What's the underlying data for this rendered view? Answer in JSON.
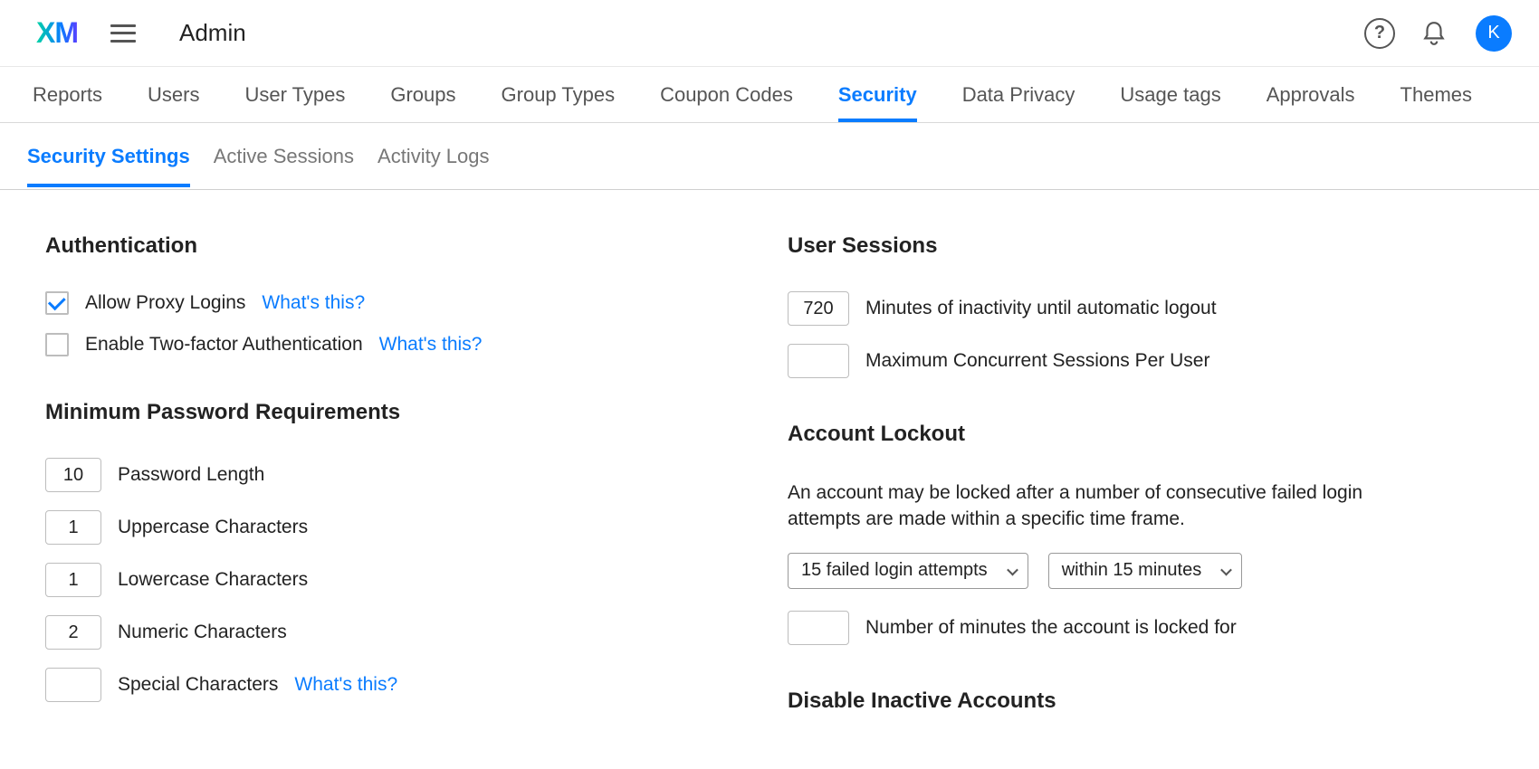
{
  "header": {
    "logo_text": "XM",
    "title": "Admin",
    "avatar_initial": "K"
  },
  "primary_tabs": [
    {
      "label": "Reports"
    },
    {
      "label": "Users"
    },
    {
      "label": "User Types"
    },
    {
      "label": "Groups"
    },
    {
      "label": "Group Types"
    },
    {
      "label": "Coupon Codes"
    },
    {
      "label": "Security",
      "active": true
    },
    {
      "label": "Data Privacy"
    },
    {
      "label": "Usage tags"
    },
    {
      "label": "Approvals"
    },
    {
      "label": "Themes"
    }
  ],
  "secondary_tabs": [
    {
      "label": "Security Settings",
      "active": true
    },
    {
      "label": "Active Sessions"
    },
    {
      "label": "Activity Logs"
    }
  ],
  "help_text": "What's this?",
  "authentication": {
    "title": "Authentication",
    "allow_proxy": {
      "label": "Allow Proxy Logins",
      "checked": true
    },
    "two_factor": {
      "label": "Enable Two-factor Authentication",
      "checked": false
    }
  },
  "password_req": {
    "title": "Minimum Password Requirements",
    "length": {
      "value": "10",
      "label": "Password Length"
    },
    "upper": {
      "value": "1",
      "label": "Uppercase Characters"
    },
    "lower": {
      "value": "1",
      "label": "Lowercase Characters"
    },
    "numeric": {
      "value": "2",
      "label": "Numeric Characters"
    },
    "special": {
      "value": "",
      "label": "Special Characters"
    }
  },
  "user_sessions": {
    "title": "User Sessions",
    "inactivity": {
      "value": "720",
      "label": "Minutes of inactivity until automatic logout"
    },
    "concurrent": {
      "value": "",
      "label": "Maximum Concurrent Sessions Per User"
    }
  },
  "account_lockout": {
    "title": "Account Lockout",
    "desc": "An account may be locked after a number of consecutive failed login attempts are made within a specific time frame.",
    "attempts_select": "15 failed login attempts",
    "window_select": "within 15 minutes",
    "lock_minutes": {
      "value": "",
      "label": "Number of minutes the account is locked for"
    }
  },
  "disable_inactive": {
    "title": "Disable Inactive Accounts"
  }
}
